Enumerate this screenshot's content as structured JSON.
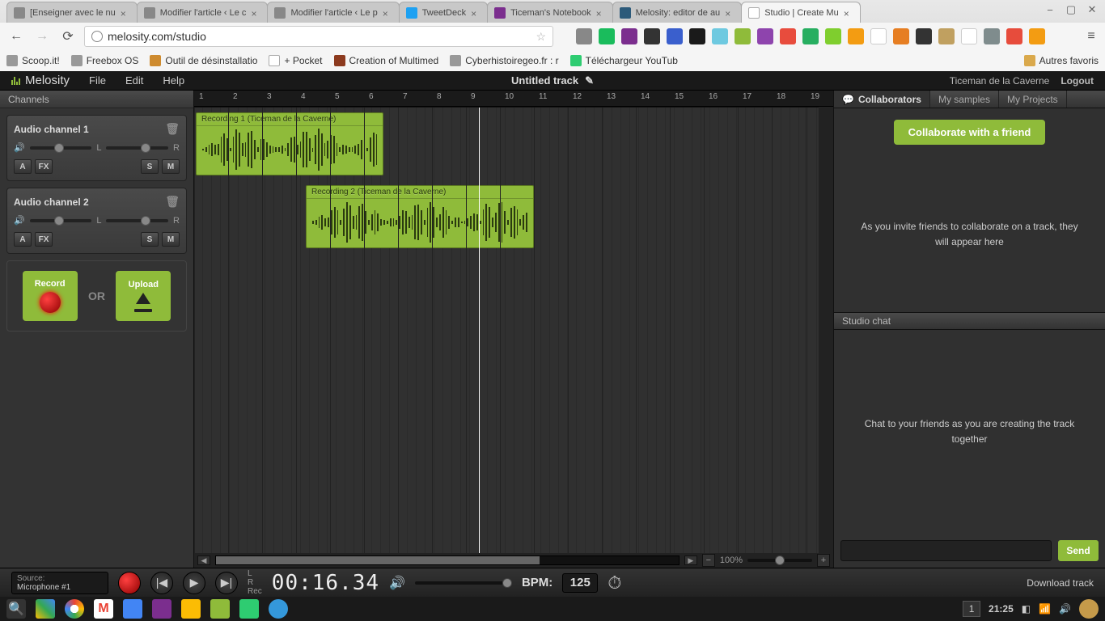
{
  "browser": {
    "tabs": [
      {
        "label": "[Enseigner avec le nu"
      },
      {
        "label": "Modifier l'article ‹ Le c"
      },
      {
        "label": "Modifier l'article ‹ Le p"
      },
      {
        "label": "TweetDeck"
      },
      {
        "label": "Ticeman's Notebook"
      },
      {
        "label": "Melosity: editor de au"
      },
      {
        "label": "Studio | Create Mu"
      }
    ],
    "url": "melosity.com/studio",
    "bookmarks": [
      "Scoop.it!",
      "Freebox OS",
      "Outil de désinstallatio",
      "+ Pocket",
      "Creation of Multimed",
      "Cyberhistoiregeo.fr : r",
      "Téléchargeur YouTub"
    ],
    "other_bookmarks": "Autres favoris"
  },
  "app": {
    "logo": "Melosity",
    "menu": [
      "File",
      "Edit",
      "Help"
    ],
    "title": "Untitled track",
    "user": "Ticeman de la Caverne",
    "logout": "Logout"
  },
  "channels_header": "Channels",
  "channels": [
    {
      "name": "Audio channel 1"
    },
    {
      "name": "Audio channel 2"
    }
  ],
  "ch_btns": {
    "A": "A",
    "FX": "FX",
    "S": "S",
    "M": "M"
  },
  "pan": {
    "L": "L",
    "R": "R"
  },
  "record_upload": {
    "record": "Record",
    "or": "OR",
    "upload": "Upload"
  },
  "clips": [
    {
      "label": "Recording 1 (Ticeman de la Caverne)"
    },
    {
      "label": "Recording 2 (Ticeman de la Caverne)"
    }
  ],
  "zoom": "100%",
  "right": {
    "tabs": [
      "Collaborators",
      "My samples",
      "My Projects"
    ],
    "collab_btn": "Collaborate with a friend",
    "collab_text": "As you invite friends to collaborate on a track, they will appear here",
    "chat_header": "Studio chat",
    "chat_text": "Chat to your friends as you are creating the track together",
    "send": "Send"
  },
  "transport": {
    "source_label": "Source:",
    "source_value": "Microphone #1",
    "L": "L",
    "R": "R",
    "Rec": "Rec",
    "time": "00:16.34",
    "bpm_label": "BPM:",
    "bpm": "125",
    "download": "Download track"
  },
  "taskbar": {
    "workspace": "1",
    "clock": "21:25"
  }
}
